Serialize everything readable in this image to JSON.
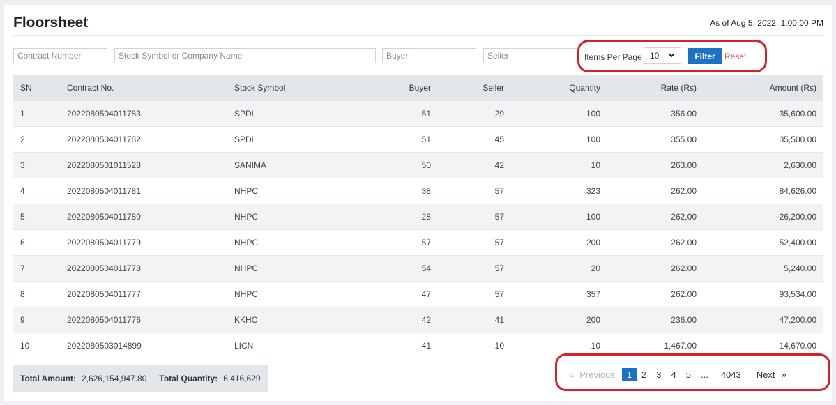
{
  "header": {
    "title": "Floorsheet",
    "as_of": "As of Aug 5, 2022, 1:00:00 PM"
  },
  "filters": {
    "contract_placeholder": "Contract Number",
    "stock_placeholder": "Stock Symbol or Company Name",
    "buyer_placeholder": "Buyer",
    "seller_placeholder": "Seller",
    "items_per_page_label": "Items Per Page",
    "items_per_page_value": "10",
    "filter_label": "Filter",
    "reset_label": "Reset"
  },
  "table": {
    "columns": [
      "SN",
      "Contract No.",
      "Stock Symbol",
      "Buyer",
      "Seller",
      "Quantity",
      "Rate (Rs)",
      "Amount (Rs)"
    ],
    "rows": [
      [
        "1",
        "2022080504011783",
        "SPDL",
        "51",
        "29",
        "100",
        "356.00",
        "35,600.00"
      ],
      [
        "2",
        "2022080504011782",
        "SPDL",
        "51",
        "45",
        "100",
        "355.00",
        "35,500.00"
      ],
      [
        "3",
        "2022080501011528",
        "SANIMA",
        "50",
        "42",
        "10",
        "263.00",
        "2,630.00"
      ],
      [
        "4",
        "2022080504011781",
        "NHPC",
        "38",
        "57",
        "323",
        "262.00",
        "84,626.00"
      ],
      [
        "5",
        "2022080504011780",
        "NHPC",
        "28",
        "57",
        "100",
        "262.00",
        "26,200.00"
      ],
      [
        "6",
        "2022080504011779",
        "NHPC",
        "57",
        "57",
        "200",
        "262.00",
        "52,400.00"
      ],
      [
        "7",
        "2022080504011778",
        "NHPC",
        "54",
        "57",
        "20",
        "262.00",
        "5,240.00"
      ],
      [
        "8",
        "2022080504011777",
        "NHPC",
        "47",
        "57",
        "357",
        "262.00",
        "93,534.00"
      ],
      [
        "9",
        "2022080504011776",
        "KKHC",
        "42",
        "41",
        "200",
        "236.00",
        "47,200.00"
      ],
      [
        "10",
        "2022080503014899",
        "LICN",
        "41",
        "10",
        "10",
        "1,467.00",
        "14,670.00"
      ]
    ]
  },
  "totals": {
    "amount_label": "Total Amount:",
    "amount_value": "2,626,154,947.80",
    "quantity_label": "Total Quantity:",
    "quantity_value": "6,416,629"
  },
  "pagination": {
    "prev_glyph": "«",
    "prev_label": "Previous",
    "pages": [
      "1",
      "2",
      "3",
      "4",
      "5",
      "...",
      "4043"
    ],
    "active_page": "1",
    "next_label": "Next",
    "next_glyph": "»"
  },
  "colors": {
    "accent": "#1a73c8",
    "reset": "#e05a5a",
    "highlight_circle": "#d8212a"
  }
}
